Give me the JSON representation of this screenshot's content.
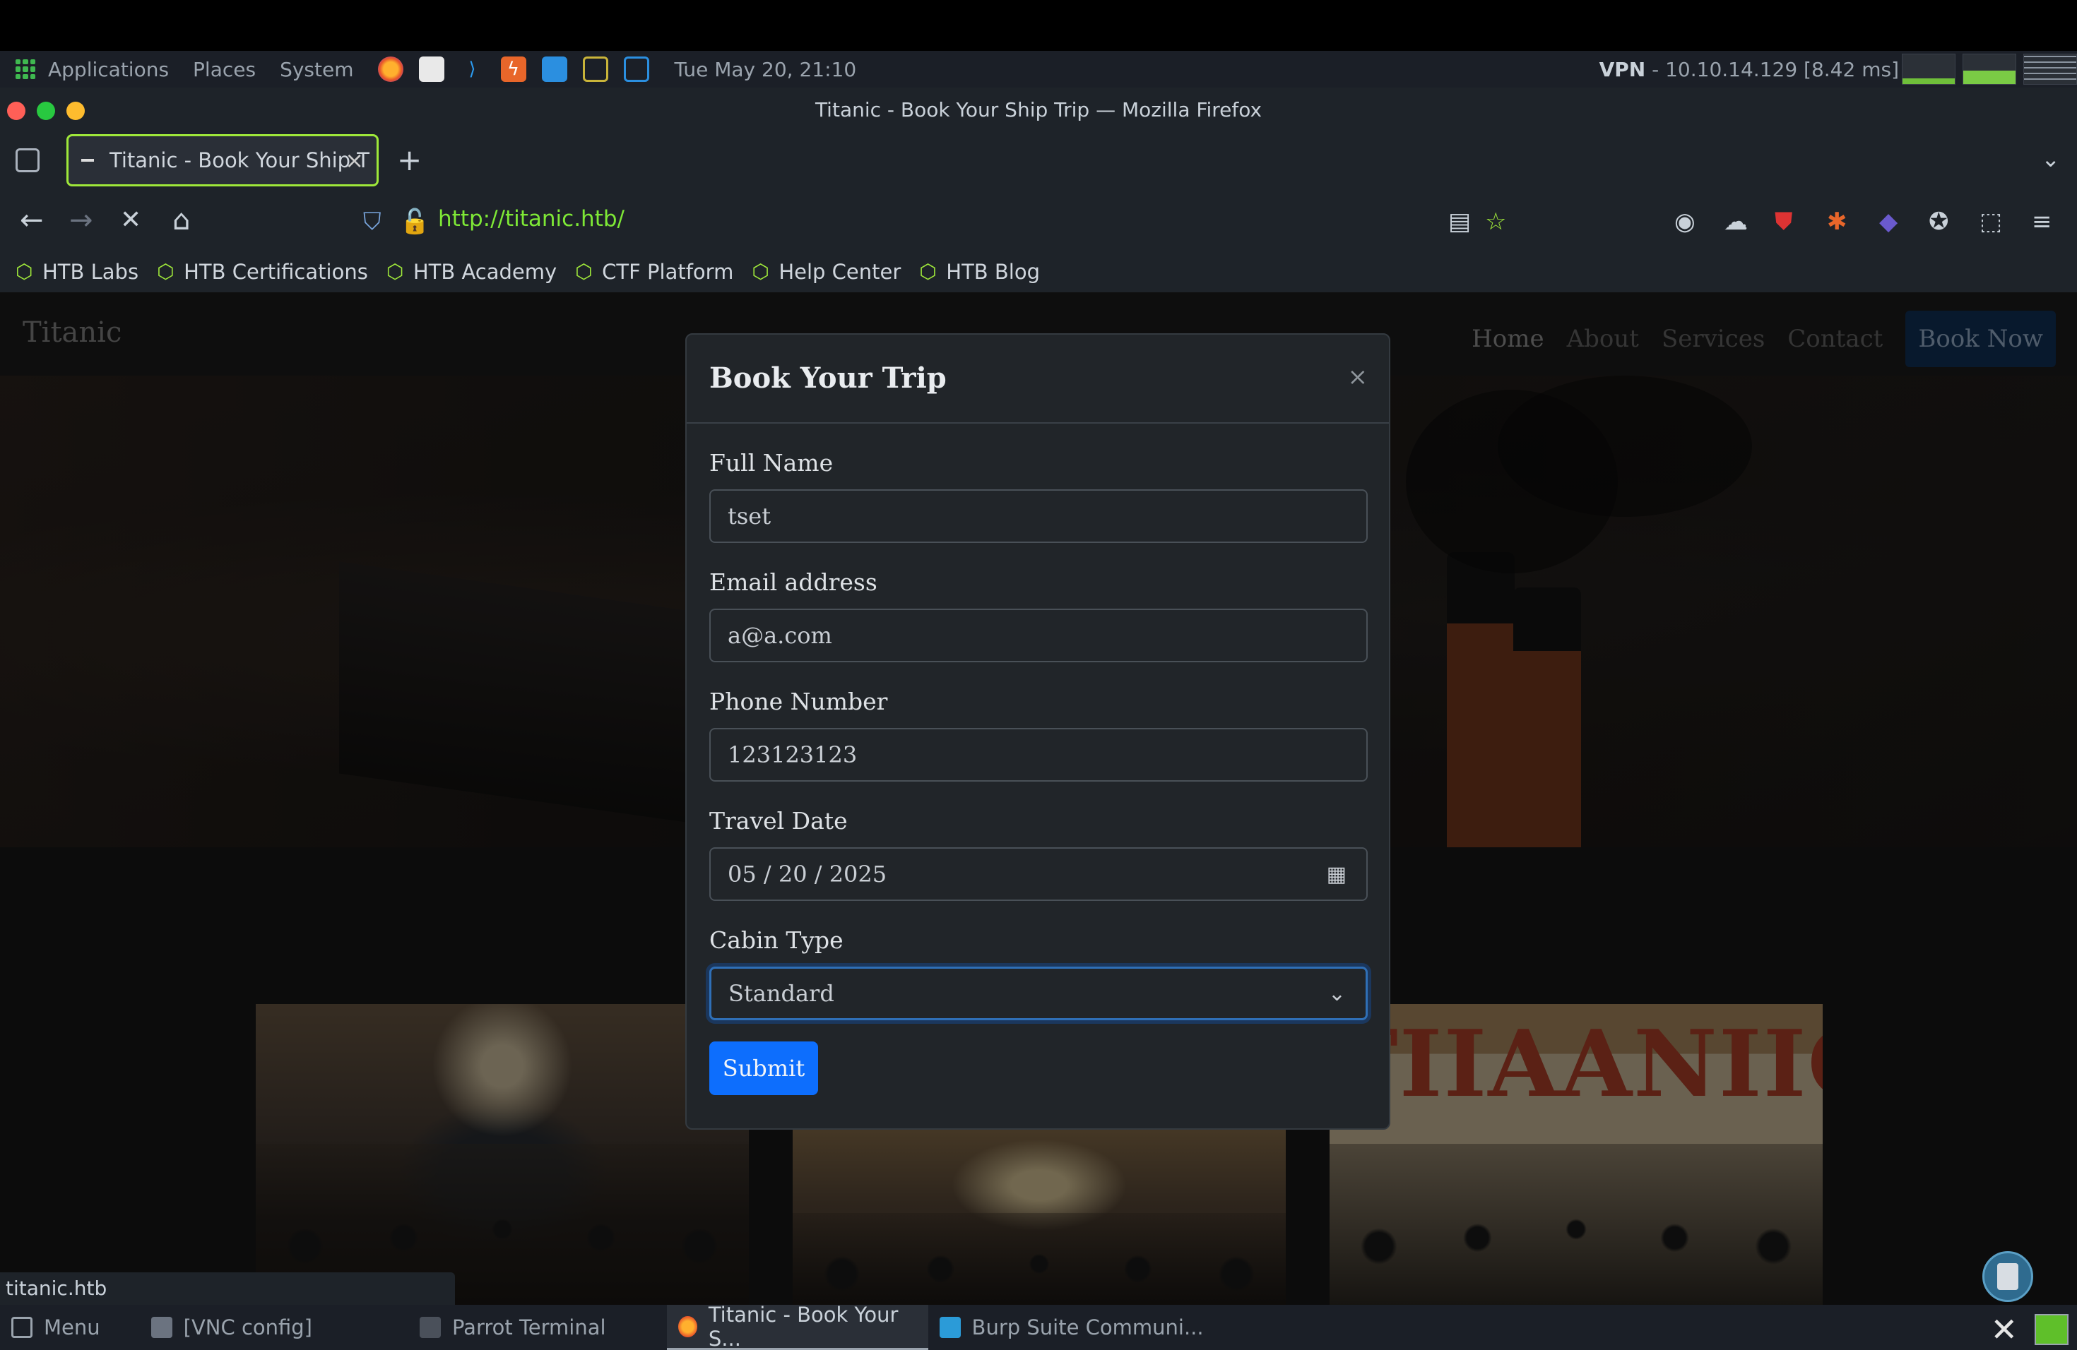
{
  "system_panel": {
    "menus": [
      "Applications",
      "Places",
      "System"
    ],
    "clock": "Tue May 20, 21:10",
    "vpn_label": "VPN",
    "vpn_detail": " - 10.10.14.129 [8.42 ms]",
    "launchers": [
      "firefox-icon",
      "text-editor-icon",
      "vscode-icon",
      "burp-icon",
      "terminal-icon",
      "window-icon",
      "powershell-icon"
    ]
  },
  "window": {
    "title": "Titanic - Book Your Ship Trip — Mozilla Firefox"
  },
  "tabs": [
    {
      "label": "Titanic - Book Your Ship T",
      "close": "×"
    }
  ],
  "tab_controls": {
    "new_tab": "+",
    "list_tabs": "⌄"
  },
  "nav": {
    "url": "http://titanic.htb/",
    "back": "←",
    "forward": "→",
    "stop": "✕",
    "home": "⌂"
  },
  "bookmarks": [
    "HTB Labs",
    "HTB Certifications",
    "HTB Academy",
    "CTF Platform",
    "Help Center",
    "HTB Blog"
  ],
  "site": {
    "brand": "Titanic",
    "links": [
      "Home",
      "About",
      "Services",
      "Contact"
    ],
    "cta": "Book Now",
    "art_text": "TIIAANIIC"
  },
  "modal": {
    "title": "Book Your Trip",
    "close": "×",
    "fields": {
      "name": {
        "label": "Full Name",
        "value": "tset"
      },
      "email": {
        "label": "Email address",
        "value": "a@a.com"
      },
      "phone": {
        "label": "Phone Number",
        "value": "123123123"
      },
      "date": {
        "label": "Travel Date",
        "value": "05 / 20 / 2025"
      },
      "cabin": {
        "label": "Cabin Type",
        "value": "Standard"
      }
    },
    "submit": "Submit"
  },
  "status_url": "titanic.htb",
  "taskbar": {
    "items": [
      {
        "label": "Menu"
      },
      {
        "label": "[VNC config]"
      },
      {
        "label": "Parrot Terminal"
      },
      {
        "label": "Titanic - Book Your S..."
      },
      {
        "label": "Burp Suite Communi..."
      }
    ]
  },
  "colors": {
    "accent_green": "#9fe83a",
    "primary_blue": "#0d6efd",
    "url_green": "#7ee836"
  }
}
